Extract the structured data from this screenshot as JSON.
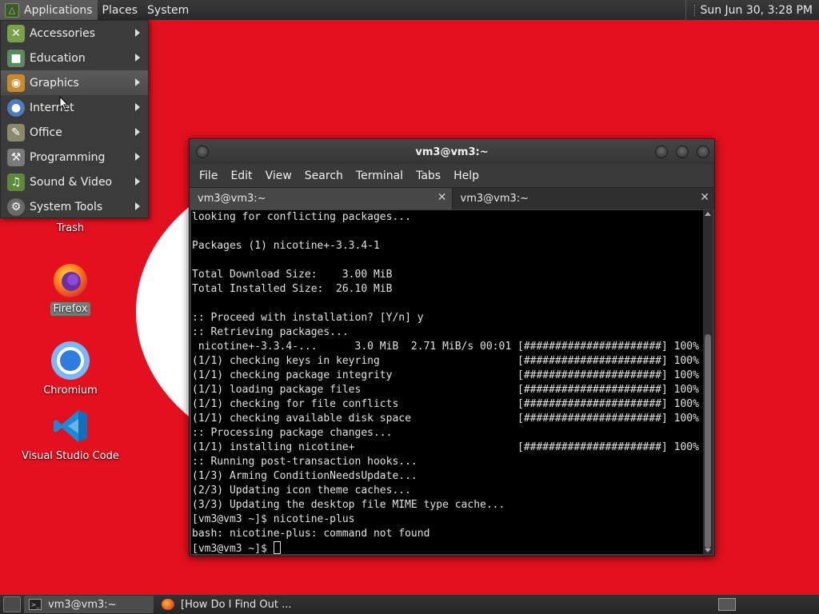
{
  "top_panel": {
    "menus": [
      "Applications",
      "Places",
      "System"
    ],
    "clock": "Sun Jun 30,  3:28 PM"
  },
  "apps_menu": {
    "items": [
      {
        "label": "Accessories",
        "icon": "accessories-icon"
      },
      {
        "label": "Education",
        "icon": "education-icon"
      },
      {
        "label": "Graphics",
        "icon": "graphics-icon"
      },
      {
        "label": "Internet",
        "icon": "internet-icon"
      },
      {
        "label": "Office",
        "icon": "office-icon"
      },
      {
        "label": "Programming",
        "icon": "programming-icon"
      },
      {
        "label": "Sound & Video",
        "icon": "sound-video-icon"
      },
      {
        "label": "System Tools",
        "icon": "system-tools-icon"
      }
    ],
    "active_index": 2
  },
  "desktop_icons": {
    "trash": "Trash",
    "firefox": "Firefox",
    "chromium": "Chromium",
    "vscode": "Visual Studio Code"
  },
  "terminal": {
    "title": "vm3@vm3:~",
    "menus": [
      "File",
      "Edit",
      "View",
      "Search",
      "Terminal",
      "Tabs",
      "Help"
    ],
    "tabs": [
      "vm3@vm3:~",
      "vm3@vm3:~"
    ],
    "output": [
      "looking for conflicting packages...",
      "",
      "Packages (1) nicotine+-3.3.4-1",
      "",
      "Total Download Size:    3.00 MiB",
      "Total Installed Size:  26.10 MiB",
      "",
      ":: Proceed with installation? [Y/n] y",
      ":: Retrieving packages...",
      " nicotine+-3.3.4-...      3.0 MiB  2.71 MiB/s 00:01 [######################] 100%",
      "(1/1) checking keys in keyring                      [######################] 100%",
      "(1/1) checking package integrity                    [######################] 100%",
      "(1/1) loading package files                         [######################] 100%",
      "(1/1) checking for file conflicts                   [######################] 100%",
      "(1/1) checking available disk space                 [######################] 100%",
      ":: Processing package changes...",
      "(1/1) installing nicotine+                          [######################] 100%",
      ":: Running post-transaction hooks...",
      "(1/3) Arming ConditionNeedsUpdate...",
      "(2/3) Updating icon theme caches...",
      "(3/3) Updating the desktop file MIME type cache...",
      "[vm3@vm3 ~]$ nicotine-plus",
      "bash: nicotine-plus: command not found"
    ],
    "prompt": "[vm3@vm3 ~]$ "
  },
  "taskbar": {
    "tasks": [
      "vm3@vm3:~",
      "[How Do I Find Out ..."
    ]
  }
}
